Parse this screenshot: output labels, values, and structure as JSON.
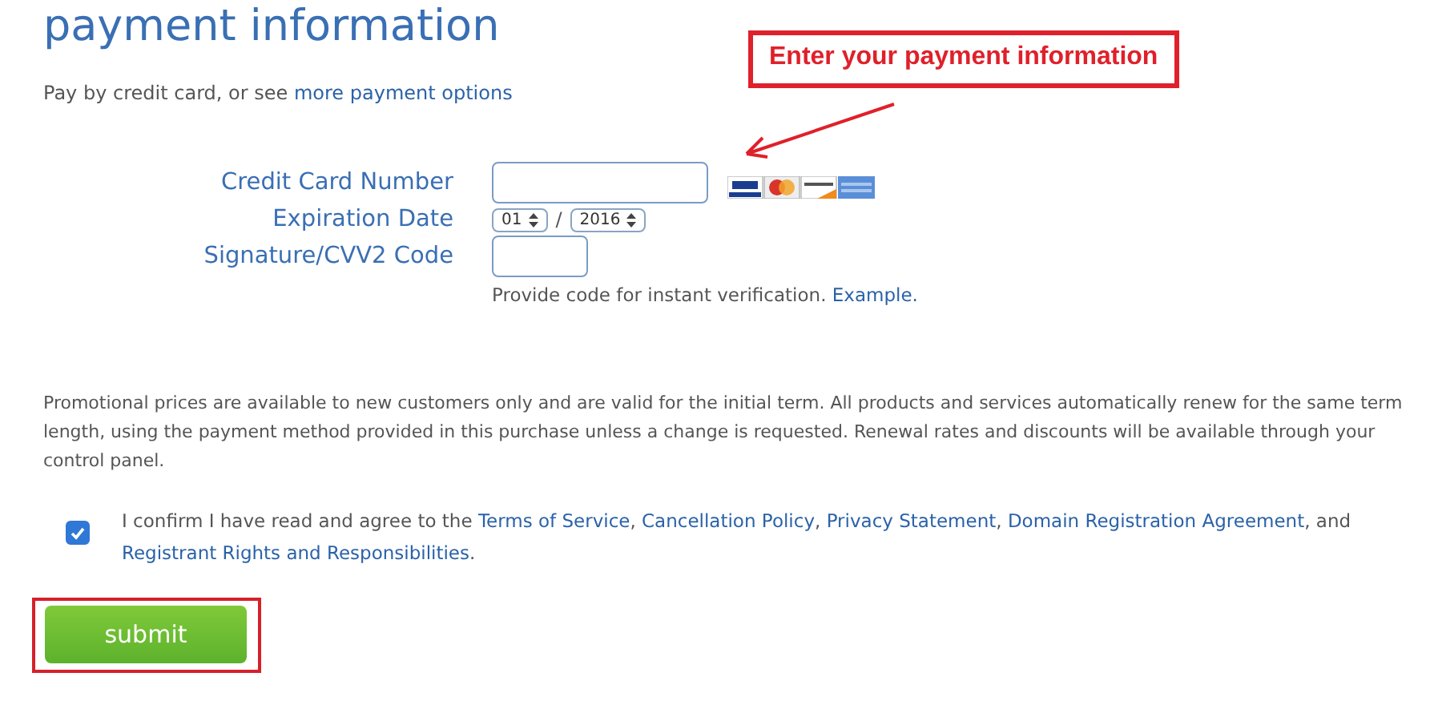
{
  "title": "payment information",
  "intro": {
    "text": "Pay by credit card, or see",
    "link": "more payment options"
  },
  "callout": {
    "text": "Enter your payment information"
  },
  "form": {
    "card_number": {
      "label": "Credit Card Number"
    },
    "expiration": {
      "label": "Expiration Date",
      "month": "01",
      "separator": "/",
      "year": "2016"
    },
    "cvv": {
      "label": "Signature/CVV2 Code",
      "help": "Provide code for instant verification.",
      "help_link": "Example."
    }
  },
  "notice": "Promotional prices are available to new customers only and are valid for the initial term. All products and services automatically renew for the same term length, using the payment method provided in this purchase unless a change is requested. Renewal rates and discounts will be available through your control panel.",
  "agreement": {
    "checked": true,
    "parts": [
      {
        "kind": "text",
        "text": "I confirm I have read and agree to the"
      },
      {
        "kind": "link",
        "text": "Terms of Service"
      },
      {
        "kind": "text",
        "text": ","
      },
      {
        "kind": "link",
        "text": "Cancellation Policy"
      },
      {
        "kind": "text",
        "text": ","
      },
      {
        "kind": "link",
        "text": "Privacy Statement"
      },
      {
        "kind": "text",
        "text": ","
      },
      {
        "kind": "link",
        "text": "Domain Registration Agreement"
      },
      {
        "kind": "text",
        "text": ", and"
      },
      {
        "kind": "link",
        "text": "Registrant Rights and Responsibilities"
      },
      {
        "kind": "text",
        "text": "."
      }
    ]
  },
  "submit": {
    "label": "submit",
    "highlighted": true
  }
}
